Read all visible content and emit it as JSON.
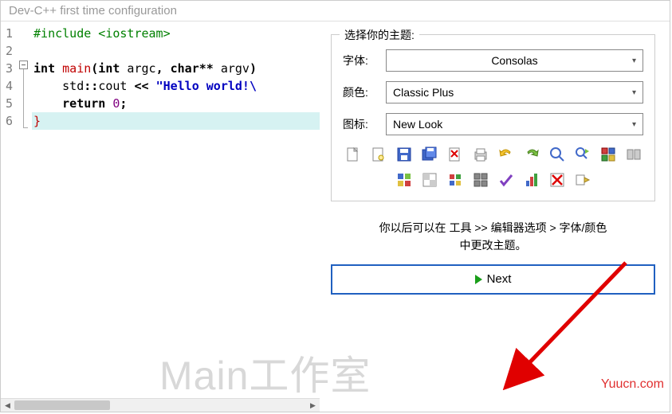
{
  "window": {
    "title": "Dev-C++ first time configuration"
  },
  "code": {
    "lines": [
      {
        "n": "1",
        "html": "<span class='hl-green'>#include &lt;iostream&gt;</span>"
      },
      {
        "n": "2",
        "html": ""
      },
      {
        "n": "3",
        "html": "<span class='hl-bold'>int</span> <span class='hl-red'>main</span><span class='hl-bold'>(int</span> argc<span class='hl-bold'>,</span> <span class='hl-bold'>char**</span> argv<span class='hl-bold'>)</span>"
      },
      {
        "n": "4",
        "html": "    std<span class='hl-bold'>::</span>cout <span class='hl-bold'>&lt;&lt;</span> <span class='hl-string'>\"Hello world!\\</span>"
      },
      {
        "n": "5",
        "html": "    <span class='hl-bold'>return</span> <span class='hl-num'>0</span><span class='hl-bold'>;</span>"
      },
      {
        "n": "6",
        "html": "<span class='hl-red'>}</span>",
        "highlight": true
      }
    ]
  },
  "theme": {
    "group_title": "选择你的主题:",
    "font_label": "字体:",
    "font_value": "Consolas",
    "color_label": "颜色:",
    "color_value": "Classic Plus",
    "icon_label": "图标:",
    "icon_value": "New Look"
  },
  "toolbar_icons": [
    "new-file-icon",
    "new-source-icon",
    "save-icon",
    "save-all-icon",
    "close-icon",
    "print-icon",
    "undo-icon",
    "redo-icon",
    "find-icon",
    "find-next-icon",
    "compile-icon",
    "run-icon",
    "compile-run-icon",
    "rebuild-icon",
    "debug-icon",
    "options-icon",
    "check-icon",
    "profile-icon",
    "stop-icon",
    "goto-icon"
  ],
  "hint": {
    "line1": "你以后可以在 工具 >> 编辑器选项   > 字体/颜色",
    "line2": "中更改主题。"
  },
  "next": {
    "label": "Next"
  },
  "watermark": {
    "main": "Main工作室",
    "url": "Yuucn.com"
  }
}
